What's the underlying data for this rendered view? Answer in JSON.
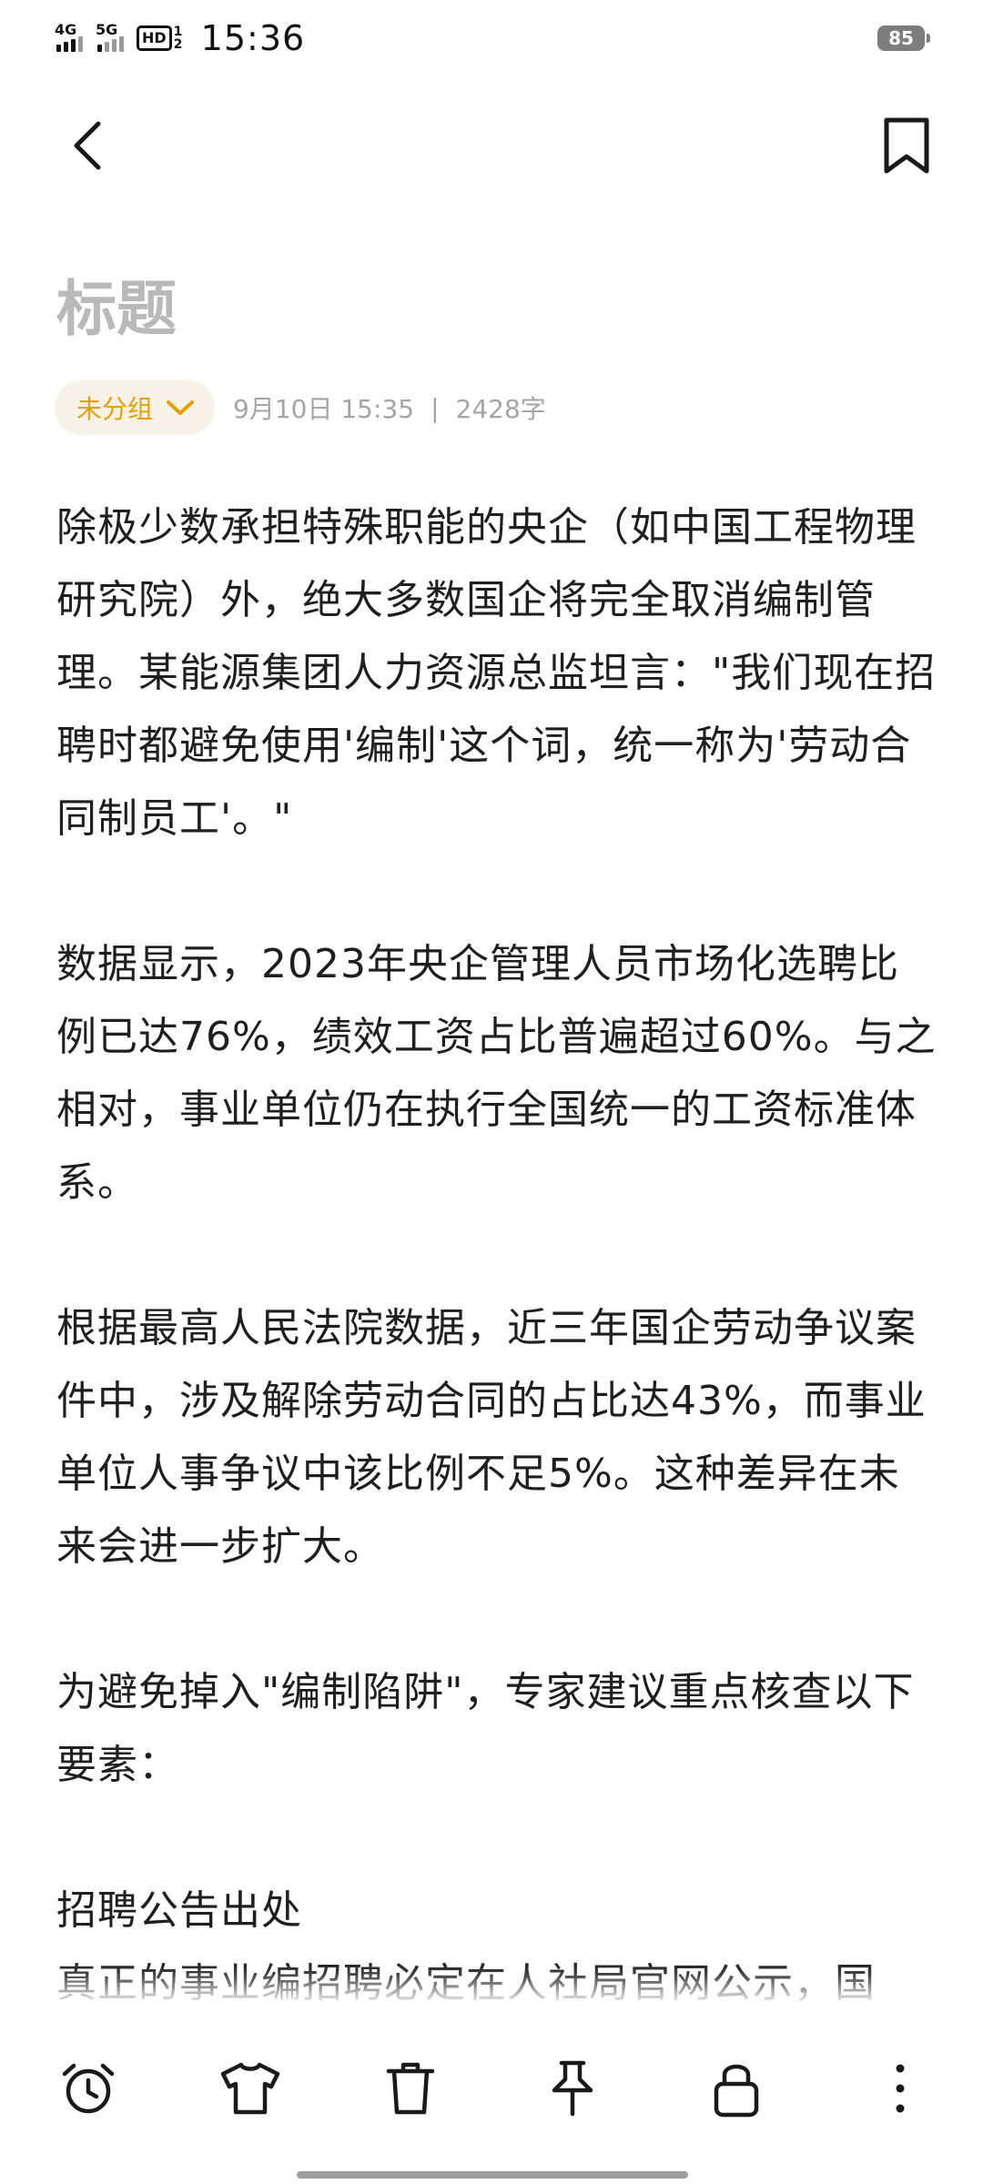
{
  "status_bar": {
    "network_1": "4G",
    "network_2": "5G",
    "hd_label": "HD",
    "hd_sub": "1 2",
    "time": "15:36",
    "battery": "85"
  },
  "note": {
    "title": "标题",
    "group_label": "未分组",
    "date": "9月10日 15:35",
    "separator": "|",
    "word_count": "2428字",
    "paragraphs": [
      "除极少数承担特殊职能的央企（如中国工程物理研究院）外，绝大多数国企将完全取消编制管理。某能源集团人力资源总监坦言：\"我们现在招聘时都避免使用'编制'这个词，统一称为'劳动合同制员工'。\"",
      "数据显示，2023年央企管理人员市场化选聘比例已达76%，绩效工资占比普遍超过60%。与之相对，事业单位仍在执行全国统一的工资标准体系。",
      "根据最高人民法院数据，近三年国企劳动争议案件中，涉及解除劳动合同的占比达43%，而事业单位人事争议中该比例不足5%。这种差异在未来会进一步扩大。",
      "为避免掉入\"编制陷阱\"，专家建议重点核查以下要素：",
      "招聘公告出处",
      "真正的事业编招聘必定在人社局官网公示，国"
    ]
  },
  "toolbar": {
    "icons": [
      "alarm-clock-icon",
      "tshirt-icon",
      "trash-icon",
      "pin-icon",
      "lock-icon",
      "more-vertical-icon"
    ]
  }
}
